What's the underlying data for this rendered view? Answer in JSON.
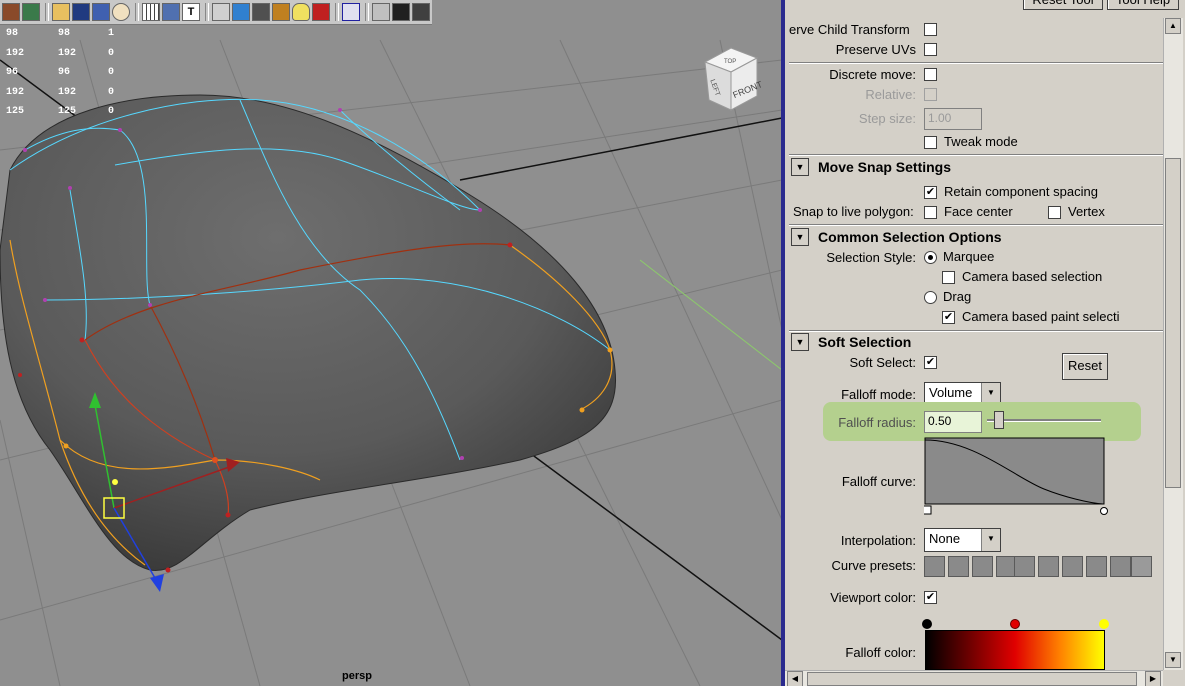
{
  "hud_stats": [
    [
      "98",
      "98",
      "1"
    ],
    [
      "192",
      "192",
      "0"
    ],
    [
      "96",
      "96",
      "0"
    ],
    [
      "192",
      "192",
      "0"
    ],
    [
      "125",
      "125",
      "0"
    ]
  ],
  "viewcube": {
    "front": "FRONT",
    "top": "TOP",
    "side": "LEFT"
  },
  "camera_label": "persp",
  "shelf_icons": [
    "paint-icon",
    "sculpt-icon",
    "layers-icon",
    "menu-icon",
    "render-icon",
    "sphere-icon",
    "grid-icon",
    "uv-icon",
    "text-icon",
    "cube-wire-icon",
    "cube-blue-icon",
    "cube-grey-icon",
    "texture-icon",
    "light-icon",
    "cube-red-icon",
    "snap-icon",
    "grid-box-icon",
    "snapshot-icon",
    "joint-icon"
  ],
  "panel": {
    "top_buttons": {
      "reset_tool": "Reset Tool",
      "tool_help": "Tool Help"
    },
    "preserve_child_transform": {
      "label": "erve Child Transform",
      "checked": false
    },
    "preserve_uvs": {
      "label": "Preserve UVs",
      "checked": false
    },
    "discrete_move": {
      "label": "Discrete move:",
      "checked": false
    },
    "relative": {
      "label": "Relative:",
      "checked": false
    },
    "step_size": {
      "label": "Step size:",
      "value": "1.00"
    },
    "tweak_mode": {
      "label": "Tweak mode",
      "checked": false
    },
    "move_snap": {
      "title": "Move Snap Settings",
      "retain_spacing": {
        "label": "Retain component spacing",
        "checked": true
      },
      "snap_live_label": "Snap to live polygon:",
      "face_center": {
        "label": "Face center",
        "checked": false
      },
      "vertex": {
        "label": "Vertex",
        "checked": false
      }
    },
    "common_selection": {
      "title": "Common Selection Options",
      "style_label": "Selection Style:",
      "marquee": "Marquee",
      "camera_based": {
        "label": "Camera based selection",
        "checked": false
      },
      "drag": "Drag",
      "camera_based_paint": {
        "label": "Camera based paint selecti",
        "checked": true
      }
    },
    "soft_selection": {
      "title": "Soft Selection",
      "soft_select": {
        "label": "Soft Select:",
        "checked": true
      },
      "reset_label": "Reset",
      "falloff_mode_label": "Falloff mode:",
      "falloff_mode_value": "Volume",
      "falloff_radius_label": "Falloff radius:",
      "falloff_radius_value": "0.50",
      "falloff_radius_fraction": 0.07,
      "falloff_curve_label": "Falloff curve:",
      "interpolation_label": "Interpolation:",
      "interpolation_value": "None",
      "curve_presets_label": "Curve presets:",
      "viewport_color": {
        "label": "Viewport color:",
        "checked": true
      },
      "falloff_color_label": "Falloff color:"
    }
  },
  "colors": {
    "highlight": "#b4d08e",
    "divider": "#2a2a8e",
    "wire_cyan": "#56d8ff",
    "wire_orange": "#f0a020"
  }
}
